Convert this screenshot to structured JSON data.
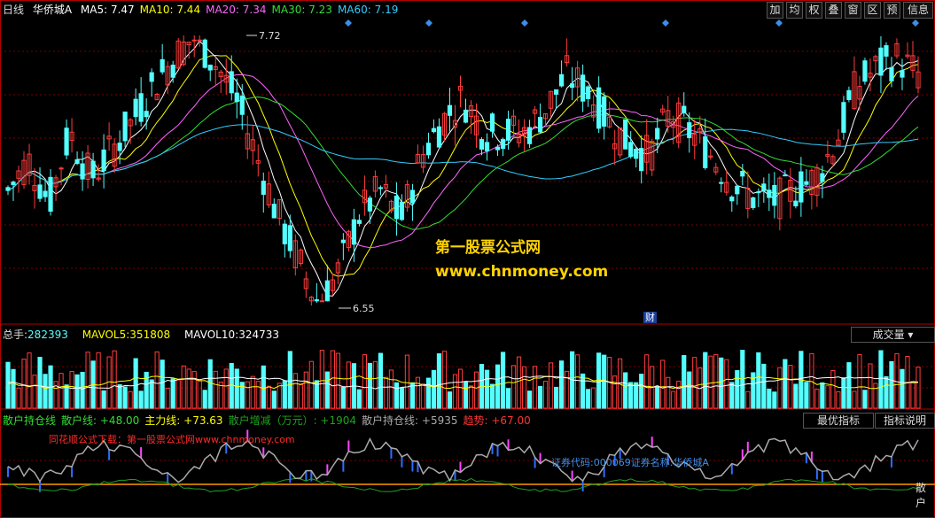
{
  "header": {
    "period": "日线",
    "stock_name": "华侨城A",
    "ma": [
      {
        "label": "MA5:",
        "value": "7.47",
        "color": "#ffffff"
      },
      {
        "label": "MA10:",
        "value": "7.44",
        "color": "#ffff00"
      },
      {
        "label": "MA20:",
        "value": "7.34",
        "color": "#ff66ff"
      },
      {
        "label": "MA30:",
        "value": "7.23",
        "color": "#33dd33"
      },
      {
        "label": "MA60:",
        "value": "7.19",
        "color": "#33ccff"
      }
    ]
  },
  "toolbar": [
    "加",
    "均",
    "权",
    "叠",
    "窗",
    "区",
    "预",
    "信息"
  ],
  "price_panel": {
    "high_label": "7.72",
    "low_label": "6.55",
    "cai_label": "财",
    "watermark_1": "第一股票公式网",
    "watermark_2": "www.chnmoney.com"
  },
  "volume_panel": {
    "label_total": "总手:",
    "value_total": "282393",
    "label_mavol5": "MAVOL5:",
    "value_mavol5": "351808",
    "label_mavol10": "MAVOL10:",
    "value_mavol10": "324733",
    "tab": "成交量"
  },
  "indicator_panel": {
    "items": [
      {
        "label": "散户持仓线",
        "value": "",
        "color": "#33dd33"
      },
      {
        "label": "散户线:",
        "value": "+48.00",
        "color": "#33dd33"
      },
      {
        "label": "主力线:",
        "value": "+73.63",
        "color": "#ffff00"
      },
      {
        "label": "散户增减（万元）:",
        "value": "+1904",
        "color": "#1fa31f"
      },
      {
        "label": "散户持仓线:",
        "value": "+5935",
        "color": "#aaaaaa"
      },
      {
        "label": "趋势:",
        "value": "+67.00",
        "color": "#ff3333"
      }
    ],
    "tab_best": "最优指标",
    "tab_help": "指标说明",
    "note_red": "同花顺公式下载：第一股票公式网www.chnmoney.com",
    "note_code": "证券代码:000069证券名称:华侨城A",
    "end_label": "散户"
  },
  "colors": {
    "up": "#ff3c3c",
    "down": "#54ffff",
    "grid": "#7a0000",
    "border": "#b00000"
  },
  "chart_data": {
    "type": "candlestick",
    "y_price_extremes": {
      "high": 7.72,
      "low": 6.55
    },
    "series": [
      {
        "name": "MA5",
        "value": 7.47
      },
      {
        "name": "MA10",
        "value": 7.44
      },
      {
        "name": "MA20",
        "value": 7.34
      },
      {
        "name": "MA30",
        "value": 7.23
      },
      {
        "name": "MA60",
        "value": 7.19
      }
    ],
    "price_path": [
      7.05,
      7.18,
      7.0,
      7.3,
      7.1,
      7.22,
      7.35,
      7.5,
      7.62,
      7.72,
      7.6,
      7.45,
      7.2,
      6.95,
      6.75,
      6.55,
      6.7,
      6.95,
      7.05,
      6.92,
      7.2,
      7.35,
      7.45,
      7.3,
      7.3,
      7.3,
      7.4,
      7.55,
      7.48,
      7.35,
      7.25,
      7.2,
      7.38,
      7.3,
      7.2,
      7.08,
      7.02,
      7.0,
      7.05,
      7.1,
      7.25,
      7.5,
      7.58,
      7.62,
      7.55
    ],
    "volume": {
      "total": 282393,
      "mavol5": 351808,
      "mavol10": 324733
    },
    "indicator": {
      "散户线": 48.0,
      "主力线": 73.63,
      "散户增减": 1904,
      "散户持仓线": 5935,
      "趋势": 67.0
    }
  }
}
